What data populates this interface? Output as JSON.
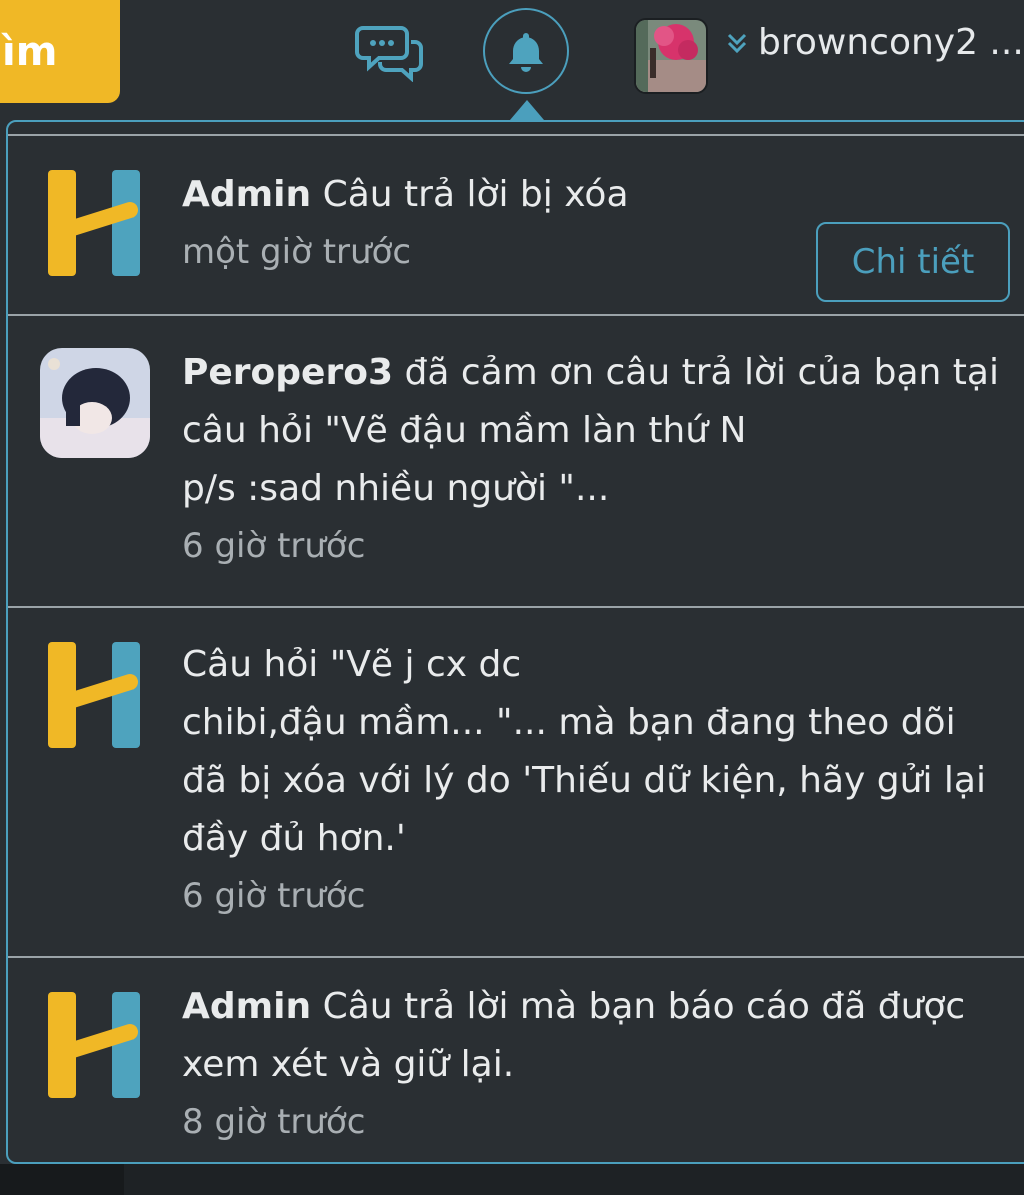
{
  "header": {
    "search_button_label": "ìm",
    "username": "browncony2 ..."
  },
  "colors": {
    "background": "#2a2f33",
    "accent": "#4b9fbd",
    "brand_yellow": "#f0b826",
    "logo_blue": "#4ea3be"
  },
  "icons": {
    "chat": "chat-bubbles-icon",
    "bell": "bell-icon",
    "chevron": "chevron-double-down-icon",
    "logo": "hoc24-logo-icon"
  },
  "notifications": [
    {
      "actor": "Admin",
      "message": "Câu trả lời bị xóa",
      "time": "một giờ trước",
      "action_label": "Chi tiết"
    },
    {
      "actor": "Peropero3",
      "message": "đã cảm ơn câu trả lời của bạn tại câu hỏi \"Vẽ đậu mầm làn thứ N",
      "message_line2": "p/s :sad nhiều người \"...",
      "time": "6 giờ trước"
    },
    {
      "actor": "",
      "message": "Câu hỏi \"Vẽ j cx dc",
      "message_line2": "chibi,đậu mầm... \"... mà bạn đang theo dõi đã bị xóa với lý do 'Thiếu dữ kiện, hãy gửi lại đầy đủ hơn.'",
      "time": "6 giờ trước"
    },
    {
      "actor": "Admin",
      "message": "Câu trả lời mà bạn báo cáo đã được xem xét và giữ lại.",
      "time": "8 giờ trước"
    }
  ]
}
